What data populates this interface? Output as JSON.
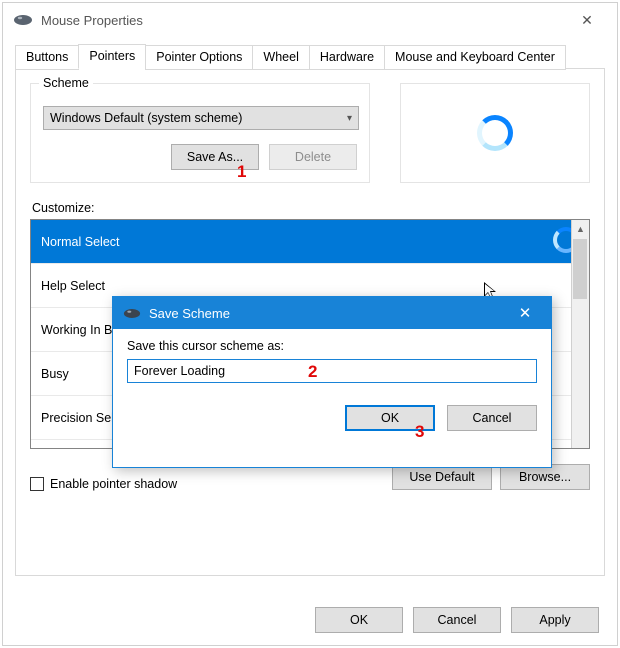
{
  "window": {
    "title": "Mouse Properties",
    "close_glyph": "✕"
  },
  "tabs": {
    "t0": "Buttons",
    "t1": "Pointers",
    "t2": "Pointer Options",
    "t3": "Wheel",
    "t4": "Hardware",
    "t5": "Mouse and Keyboard Center"
  },
  "scheme": {
    "legend": "Scheme",
    "selected": "Windows Default (system scheme)",
    "save_as": "Save As...",
    "delete": "Delete"
  },
  "customize_label": "Customize:",
  "list": {
    "i0": "Normal Select",
    "i1": "Help Select",
    "i2": "Working In Background",
    "i3": "Busy",
    "i4": "Precision Select"
  },
  "enable_shadow": "Enable pointer shadow",
  "use_default": "Use Default",
  "browse": "Browse...",
  "footer": {
    "ok": "OK",
    "cancel": "Cancel",
    "apply": "Apply"
  },
  "modal": {
    "title": "Save Scheme",
    "label": "Save this cursor scheme as:",
    "value": "Forever Loading",
    "ok": "OK",
    "cancel": "Cancel",
    "close_glyph": "✕"
  },
  "annotations": {
    "n1": "1",
    "n2": "2",
    "n3": "3"
  }
}
